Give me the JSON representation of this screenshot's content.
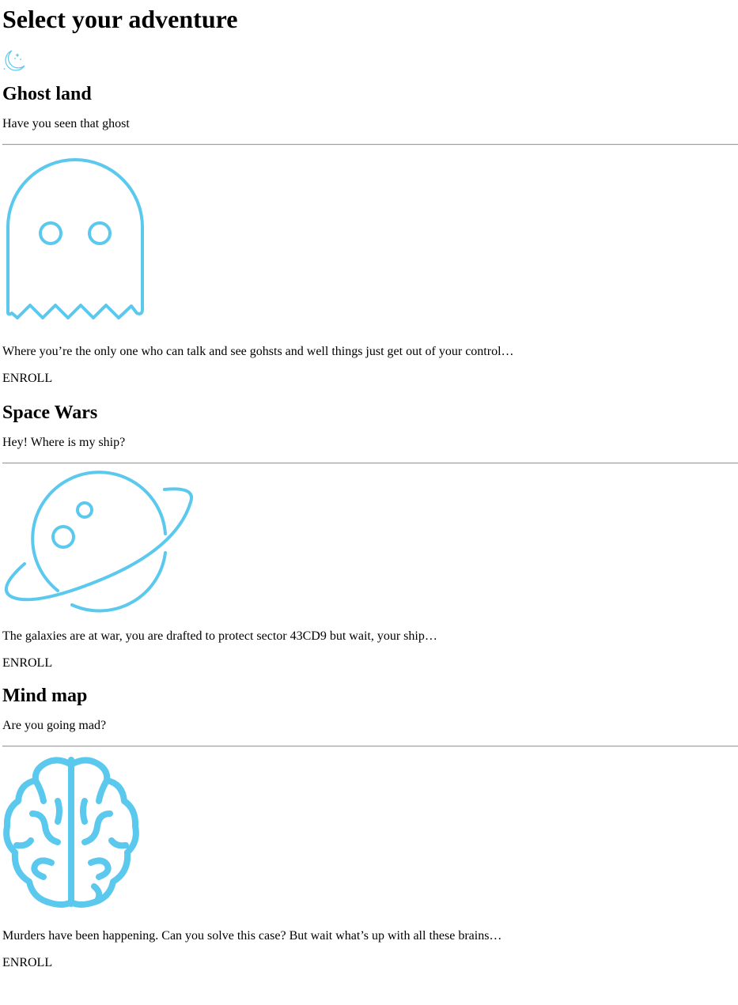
{
  "page": {
    "title": "Select your adventure"
  },
  "header_icon": "moon-stars-icon",
  "accent_color": "#5bc8ee",
  "adventures": [
    {
      "title": "Ghost land",
      "tagline": "Have you seen that ghost",
      "icon": "ghost-icon",
      "description": "Where you’re the only one who can talk and see gohsts and well things just get out of your control…",
      "button_label": "ENROLL"
    },
    {
      "title": "Space Wars",
      "tagline": "Hey! Where is my ship?",
      "icon": "planet-icon",
      "description": "The galaxies are at war, you are drafted to protect sector 43CD9 but wait, your ship…",
      "button_label": "ENROLL"
    },
    {
      "title": "Mind map",
      "tagline": "Are you going mad?",
      "icon": "brain-icon",
      "description": "Murders have been happening. Can you solve this case? But wait what’s up with all these brains…",
      "button_label": "ENROLL"
    }
  ]
}
